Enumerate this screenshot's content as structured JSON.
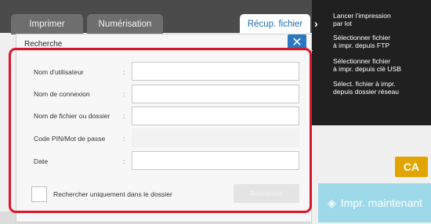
{
  "tabs": [
    {
      "label": "Imprimer"
    },
    {
      "label": "Numérisation"
    },
    {
      "label": "Récup. fichier"
    }
  ],
  "side_menu": [
    {
      "label": "Lancer l'impression\npar lot"
    },
    {
      "label": "Sélectionner fichier\nà impr. depuis FTP"
    },
    {
      "label": "Sélectionner fichier\nà impr. depuis clé USB"
    },
    {
      "label": "Sélect. fichier à impr.\ndepuis dossier réseau"
    }
  ],
  "ca_label": "CA",
  "print_now_label": "Impr. maintenant",
  "dialog": {
    "title": "Recherche",
    "fields": [
      {
        "label": "Nom d'utilisateur",
        "value": ""
      },
      {
        "label": "Nom de connexion",
        "value": ""
      },
      {
        "label": "Nom de fichier ou dossier",
        "value": ""
      },
      {
        "label": "Code PIN/Mot de passe",
        "value": ""
      },
      {
        "label": "Date",
        "value": ""
      }
    ],
    "folder_only_label": "Rechercher uniquement dans le dossier",
    "search_button": "Recherche"
  },
  "colors": {
    "accent_red": "#d9172c",
    "close_blue": "#2b78c0",
    "ca_yellow": "#e2a500",
    "print_now_blue": "#9ed9ea"
  }
}
